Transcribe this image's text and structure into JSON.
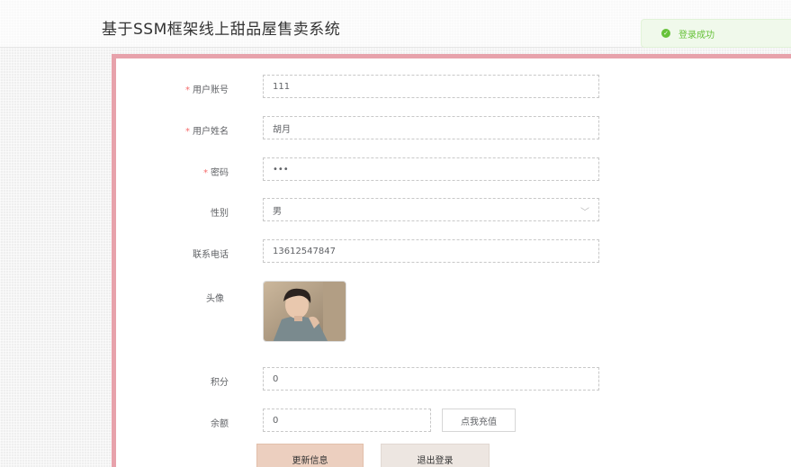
{
  "app": {
    "title": "基于SSM框架线上甜品屋售卖系统"
  },
  "toast": {
    "message": "登录成功",
    "icon": "check-circle-icon"
  },
  "form": {
    "account": {
      "label": "用户账号",
      "value": "111",
      "required": true
    },
    "name": {
      "label": "用户姓名",
      "value": "胡月",
      "required": true
    },
    "password": {
      "label": "密码",
      "value": "•••",
      "required": true
    },
    "gender": {
      "label": "性别",
      "value": "男"
    },
    "phone": {
      "label": "联系电话",
      "value": "13612547847"
    },
    "avatar": {
      "label": "头像"
    },
    "points": {
      "label": "积分",
      "value": "0"
    },
    "balance": {
      "label": "余额",
      "value": "0",
      "recharge_label": "点我充值"
    }
  },
  "actions": {
    "update_label": "更新信息",
    "logout_label": "退出登录"
  },
  "colors": {
    "panel_border": "#e7a2ab",
    "update_button": "#eccfbf",
    "logout_button": "#ede6e1",
    "success": "#67c23a"
  }
}
